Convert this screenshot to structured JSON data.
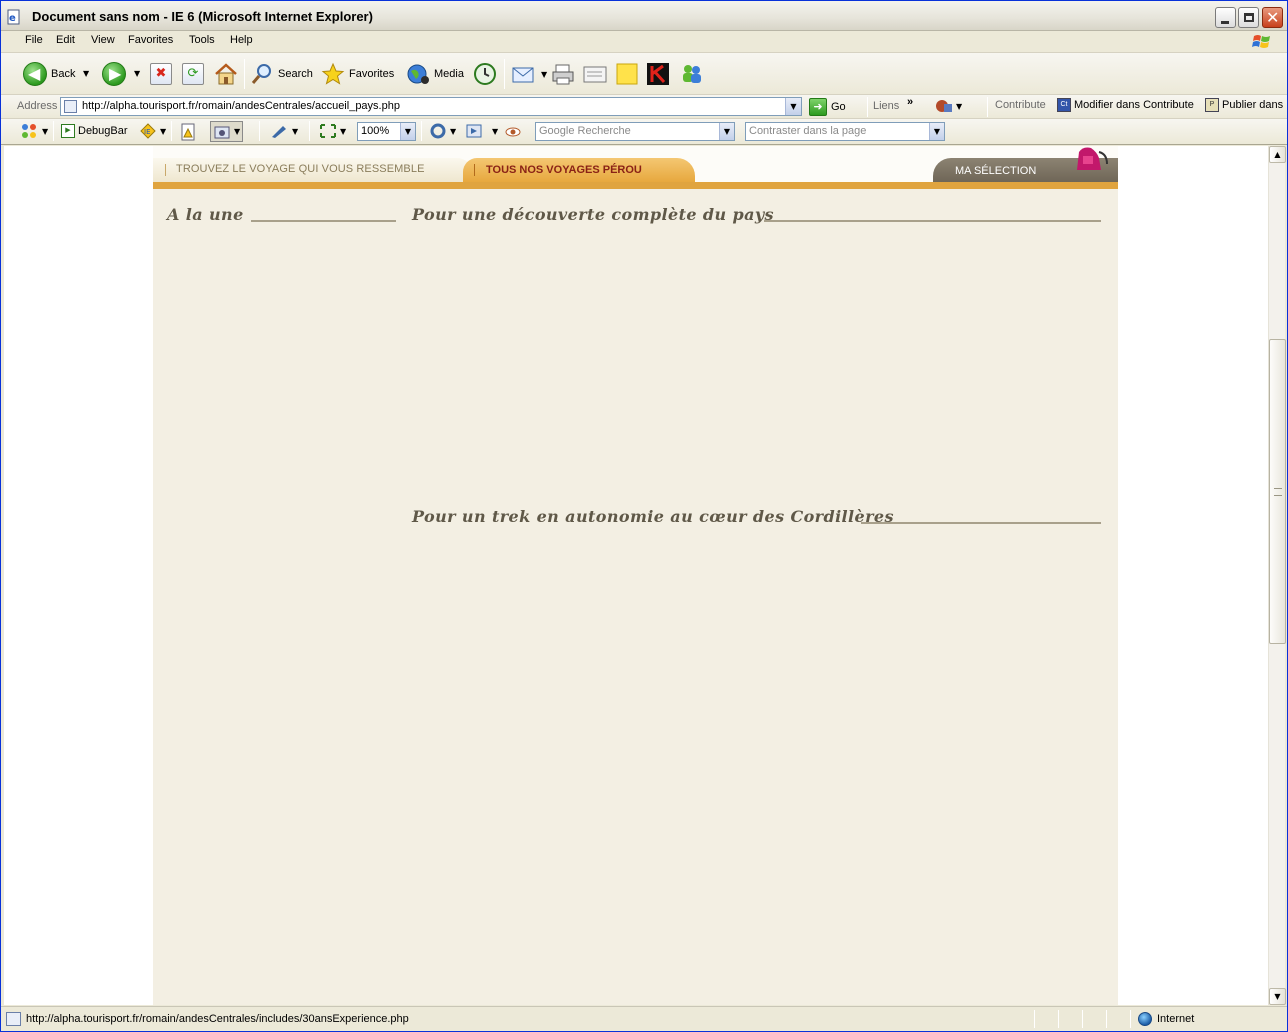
{
  "window": {
    "title": "Document sans nom - IE 6 (Microsoft Internet Explorer)"
  },
  "menu": [
    "File",
    "Edit",
    "View",
    "Favorites",
    "Tools",
    "Help"
  ],
  "toolbar": {
    "back_label": "Back",
    "search_label": "Search",
    "favorites_label": "Favorites",
    "media_label": "Media"
  },
  "address_bar": {
    "label": "Address",
    "url": "http://alpha.tourisport.fr/romain/andesCentrales/accueil_pays.php",
    "go_label": "Go",
    "links_label": "Liens",
    "links_chevron": "»",
    "contribute_label": "Contribute",
    "modify_label": "Modifier dans Contribute",
    "publish_label": "Publier dans"
  },
  "devbar": {
    "debugbar_label": "DebugBar",
    "zoom_value": "100%",
    "google_placeholder": "Google Recherche",
    "contrast_placeholder": "Contraster dans la page"
  },
  "page": {
    "nav_tabs": {
      "find": "TROUVEZ LE VOYAGE QUI VOUS RESSEMBLE",
      "peru": "TOUS NOS VOYAGES PÉROU",
      "selection": "MA SÉLECTION"
    },
    "sections": {
      "featured": "A la une",
      "discovery": "Pour une découverte complète du pays",
      "trek": "Pour un trek en autonomie au cœur des Cordillères"
    }
  },
  "status_bar": {
    "url": "http://alpha.tourisport.fr/romain/andesCentrales/includes/30ansExperience.php",
    "zone": "Internet"
  },
  "icons": {
    "close_glyph": "✕",
    "back_arrow": "◀",
    "forward_arrow": "▶",
    "dropdown": "▼"
  }
}
